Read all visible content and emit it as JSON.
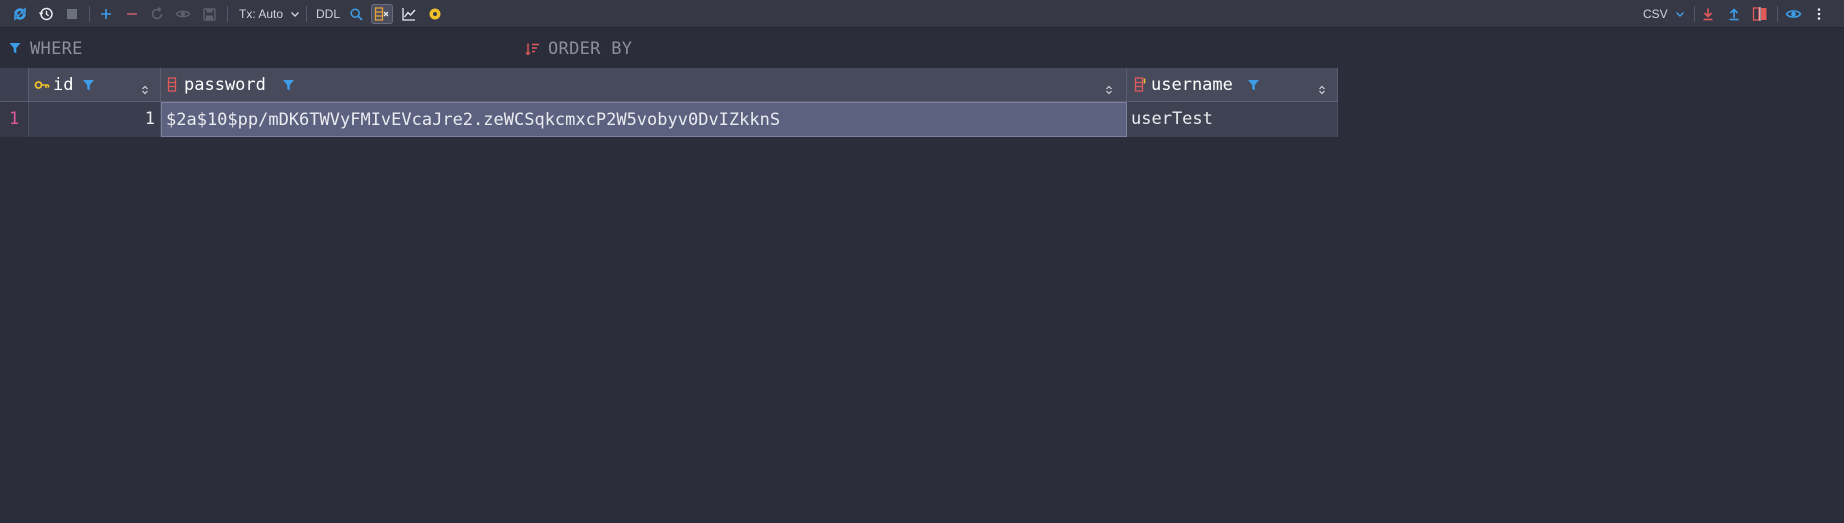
{
  "toolbar": {
    "tx_label": "Tx: Auto",
    "ddl_label": "DDL",
    "export_format": "CSV"
  },
  "filter": {
    "where_label": "WHERE",
    "order_by_label": "ORDER BY"
  },
  "table": {
    "columns": [
      {
        "name": "id",
        "icon": "key-icon"
      },
      {
        "name": "password",
        "icon": "column-icon"
      },
      {
        "name": "username",
        "icon": "index-column-icon"
      }
    ],
    "rows": [
      {
        "row_number": "1",
        "id": "1",
        "password": "$2a$10$pp/mDK6TWVyFMIvEVcaJre2.zeWCSqkcmxcP2W5vobyv0DvIZkknS",
        "username": "userTest"
      }
    ]
  },
  "colors": {
    "accent_blue": "#3d9ee8",
    "add_blue": "#3d9ee8",
    "remove_red": "#e05a5a",
    "row_number_pink": "#e0589c",
    "key_yellow": "#f0c02a",
    "selected_cell": "#5c6180"
  }
}
